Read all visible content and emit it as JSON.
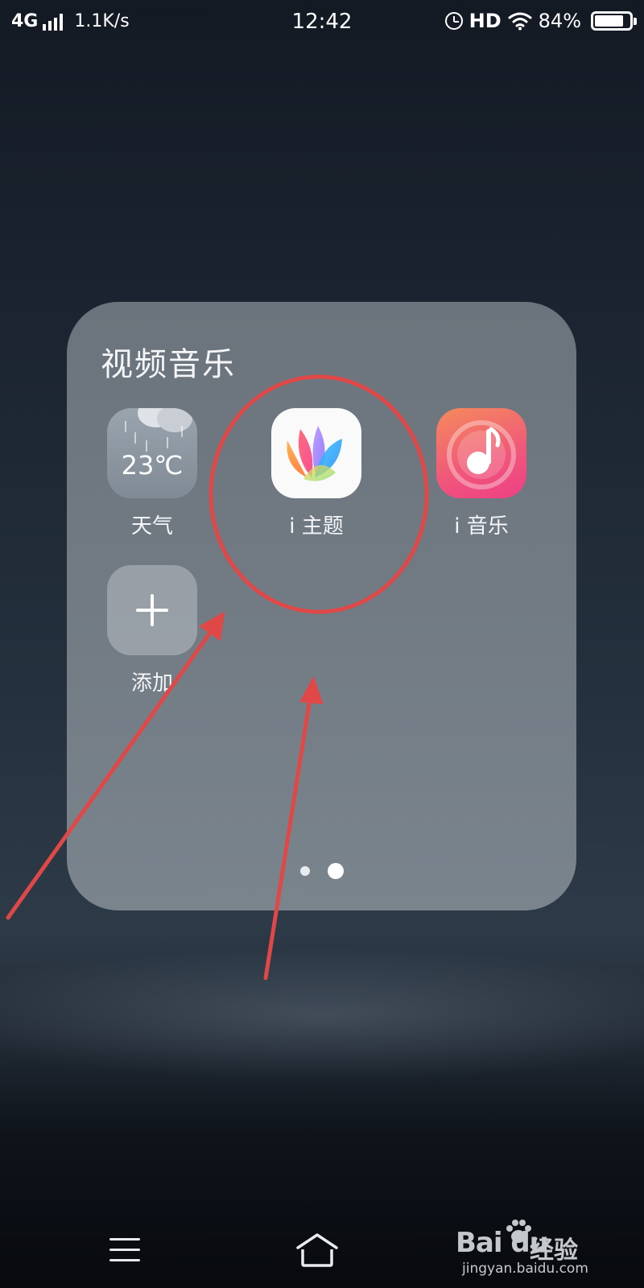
{
  "status_bar": {
    "network": "4G",
    "speed": "1.1K/s",
    "time": "12:42",
    "hd": "HD",
    "battery_text": "84%",
    "battery_level": 0.84
  },
  "folder": {
    "title": "视频音乐",
    "apps": [
      {
        "label": "天气",
        "icon": "weather-icon",
        "temperature": "23℃"
      },
      {
        "label": "i 主题",
        "icon": "lotus-icon"
      },
      {
        "label": "i 音乐",
        "icon": "music-note-icon"
      },
      {
        "label": "添加",
        "icon": "plus-icon"
      }
    ],
    "page_count": 2,
    "current_page": 2
  },
  "annotations": {
    "highlight_color": "#e04848",
    "circled_app": "i 主题"
  },
  "nav_bar": {
    "menu_icon": "menu-icon",
    "home_icon": "home-icon"
  },
  "watermark": {
    "logo": "Bai du",
    "brand": "经验",
    "url": "jingyan.baidu.com"
  }
}
